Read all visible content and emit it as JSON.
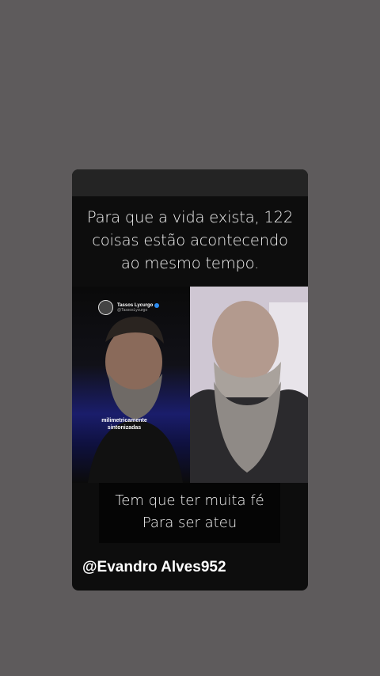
{
  "headline": {
    "line1": "Para que a vida exista, 122",
    "line2": "coisas estão acontecendo",
    "line3": "ao mesmo tempo."
  },
  "video_left": {
    "tag_name": "Tassos Lycurgo",
    "tag_handle": "@TassosLycurgo",
    "caption_line1": "milimetricamente",
    "caption_line2": "sintonizadas"
  },
  "subtitle": {
    "line1": "Tem que ter muita fé",
    "line2": "Para ser ateu"
  },
  "watermark": "@Evandro Alves952",
  "colors": {
    "background": "#5e5b5c",
    "card": "#0d0d0d",
    "verified_badge": "#2d8cf0"
  }
}
